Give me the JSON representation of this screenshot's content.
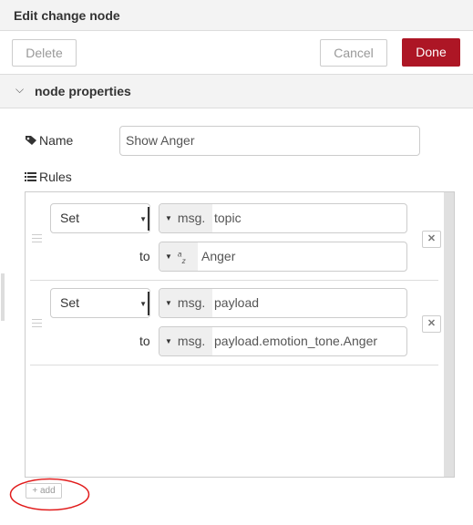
{
  "header": {
    "title": "Edit change node"
  },
  "toolbar": {
    "delete_label": "Delete",
    "cancel_label": "Cancel",
    "done_label": "Done"
  },
  "section": {
    "title": "node properties",
    "chevron_icon": "chevron-down-icon"
  },
  "name_field": {
    "label": "Name",
    "value": "Show Anger",
    "icon": "tag-icon"
  },
  "rules": {
    "label": "Rules",
    "icon": "list-icon",
    "items": [
      {
        "action": "Set",
        "target_type": "msg.",
        "target_value": "topic",
        "to_label": "to",
        "source_type_icon": "a-z-string-icon",
        "source_value": "Anger"
      },
      {
        "action": "Set",
        "target_type": "msg.",
        "target_value": "payload",
        "to_label": "to",
        "source_type": "msg.",
        "source_value": "payload.emotion_tone.Anger"
      }
    ],
    "add_label": "add"
  },
  "colors": {
    "accent": "#ad1625",
    "annotation": "#e11c1c"
  }
}
